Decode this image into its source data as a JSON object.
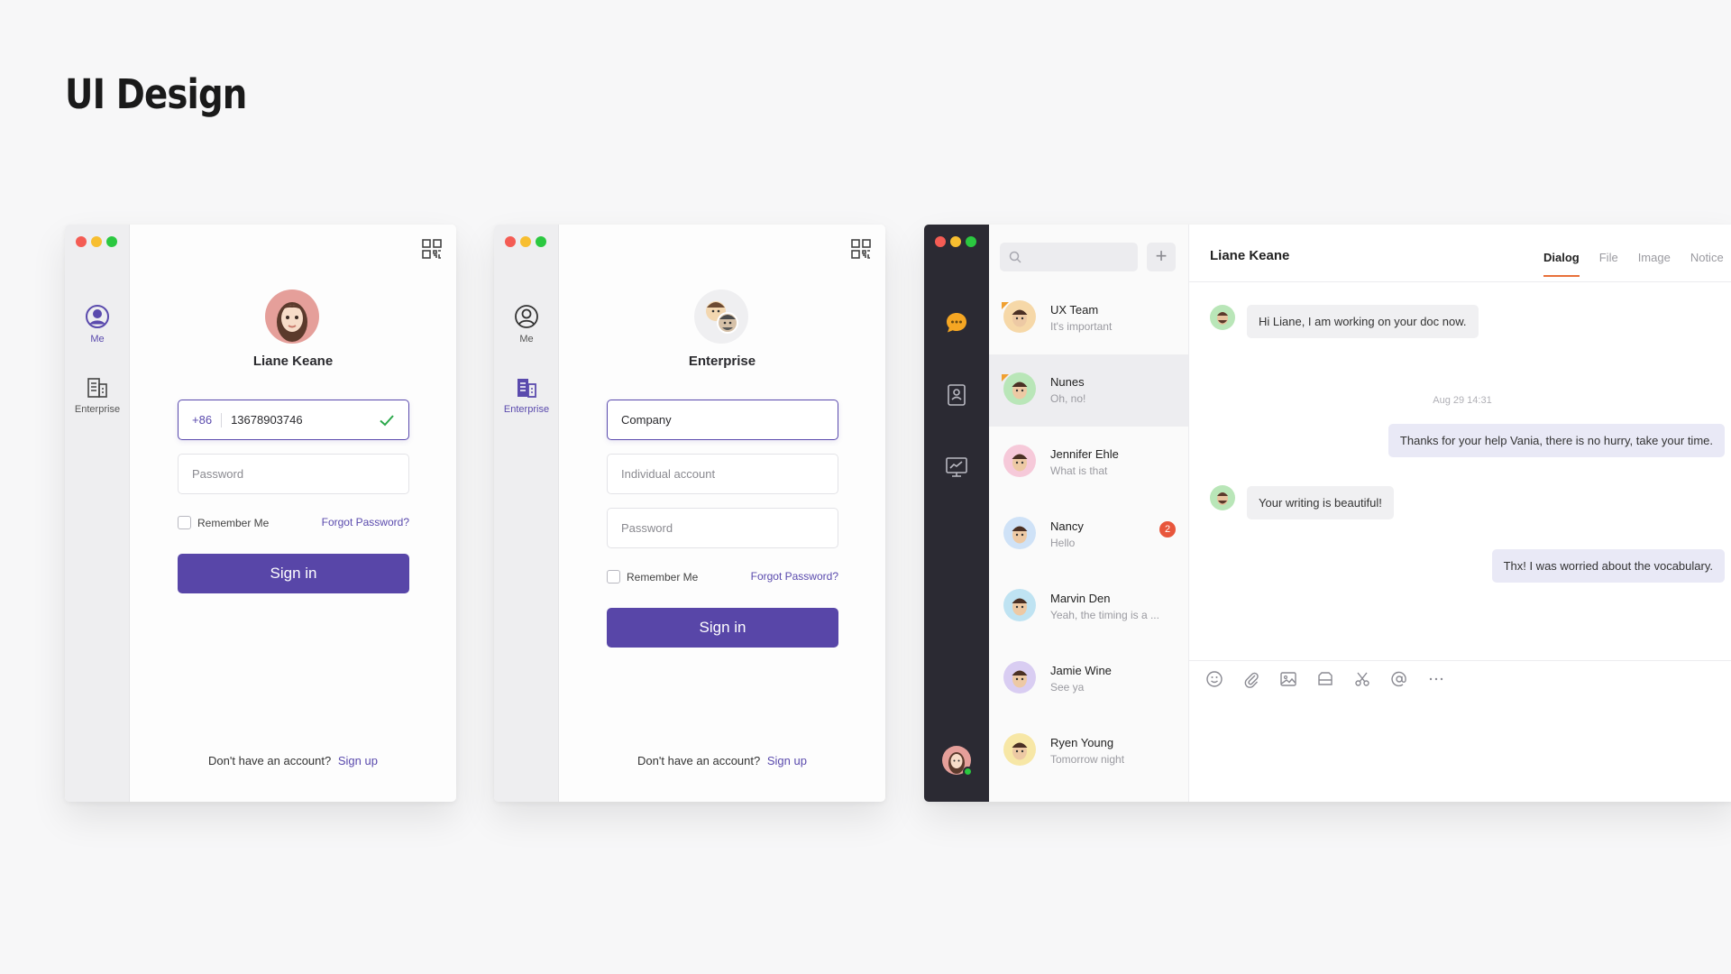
{
  "page": {
    "title": "UI Design"
  },
  "colors": {
    "accent": "#5846a8",
    "badge": "#e8563c",
    "tab_underline": "#e8703a",
    "online": "#2bc840"
  },
  "login_personal": {
    "nav": {
      "me": "Me",
      "enterprise": "Enterprise",
      "active": "me"
    },
    "profile_name": "Liane Keane",
    "phone_prefix": "+86",
    "phone_value": "13678903746",
    "password_placeholder": "Password",
    "remember_label": "Remember Me",
    "forgot_label": "Forgot Password?",
    "signin_label": "Sign in",
    "signup_prompt": "Don't have an account?",
    "signup_link": "Sign up"
  },
  "login_enterprise": {
    "nav": {
      "me": "Me",
      "enterprise": "Enterprise",
      "active": "enterprise"
    },
    "profile_name": "Enterprise",
    "company_value": "Company",
    "account_placeholder": "Individual account",
    "password_placeholder": "Password",
    "remember_label": "Remember Me",
    "forgot_label": "Forgot Password?",
    "signin_label": "Sign in",
    "signup_prompt": "Don't have an account?",
    "signup_link": "Sign up"
  },
  "chat": {
    "add_label": "+",
    "conversations": [
      {
        "name": "UX Team",
        "preview": "It's important",
        "avatar": "#f6d8a8"
      },
      {
        "name": "Nunes",
        "preview": "Oh, no!",
        "avatar": "#b9e6b8"
      },
      {
        "name": "Jennifer Ehle",
        "preview": "What is that",
        "avatar": "#f6c9d9"
      },
      {
        "name": "Nancy",
        "preview": "Hello",
        "avatar": "#cfe2f7",
        "badge": "2"
      },
      {
        "name": "Marvin Den",
        "preview": "Yeah, the timing is a ...",
        "avatar": "#bfe3f2"
      },
      {
        "name": "Jamie Wine",
        "preview": "See ya",
        "avatar": "#d9cdf2"
      },
      {
        "name": "Ryen Young",
        "preview": "Tomorrow night",
        "avatar": "#f7e7a6"
      }
    ],
    "header": {
      "title": "Liane Keane"
    },
    "tabs": [
      "Dialog",
      "File",
      "Image",
      "Notice"
    ],
    "active_tab": "Dialog",
    "messages": [
      {
        "dir": "in",
        "text": "Hi Liane, I am working on your doc now."
      },
      {
        "dir": "out",
        "text": "Thanks for your help Vania, there is no hurry, take your time."
      },
      {
        "dir": "in",
        "text": "Your writing is beautiful!"
      },
      {
        "dir": "out",
        "text": "Thx! I was worried about the vocabulary."
      }
    ],
    "timestamp": "Aug 29  14:31",
    "toolbar_icons": [
      "emoji-icon",
      "attachment-icon",
      "image-icon",
      "folder-icon",
      "scissors-icon",
      "at-icon",
      "more-icon"
    ]
  }
}
